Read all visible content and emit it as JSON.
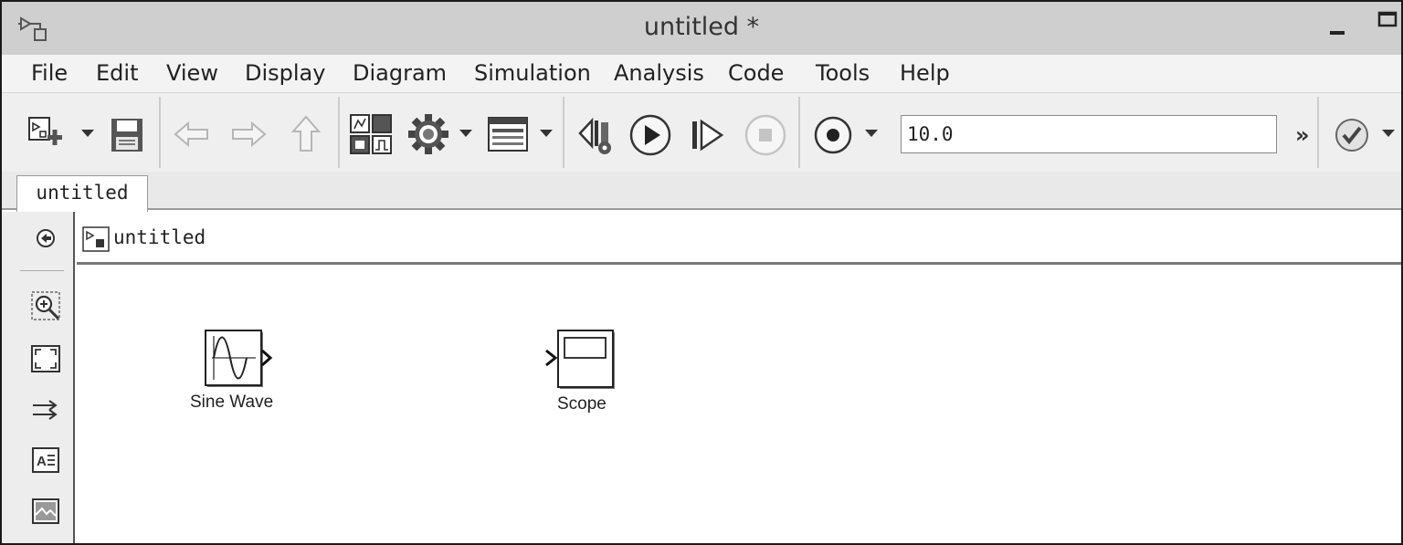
{
  "window": {
    "title": "untitled *",
    "minimize_glyph": "minimize-icon",
    "maximize_glyph": "maximize-icon"
  },
  "menu": [
    "File",
    "Edit",
    "View",
    "Display",
    "Diagram",
    "Simulation",
    "Analysis",
    "Code",
    "Tools",
    "Help"
  ],
  "toolbar": {
    "stop_time": "10.0",
    "overflow_label": "»",
    "icons": [
      "new-model-icon",
      "save-icon",
      "back-icon",
      "forward-icon",
      "up-icon",
      "library-browser-icon",
      "model-config-icon",
      "model-explorer-icon",
      "step-back-icon",
      "run-icon",
      "step-forward-icon",
      "stop-icon",
      "record-icon",
      "check-icon"
    ]
  },
  "tabs": [
    {
      "label": "untitled",
      "active": true
    }
  ],
  "explorer": {
    "path": "untitled"
  },
  "palette": [
    "hide-browser-icon",
    "zoom-icon",
    "fit-to-view-icon",
    "signal-routing-icon",
    "annotation-icon",
    "image-icon"
  ],
  "blocks": [
    {
      "name": "Sine Wave",
      "kind": "source"
    },
    {
      "name": "Scope",
      "kind": "sink"
    }
  ]
}
